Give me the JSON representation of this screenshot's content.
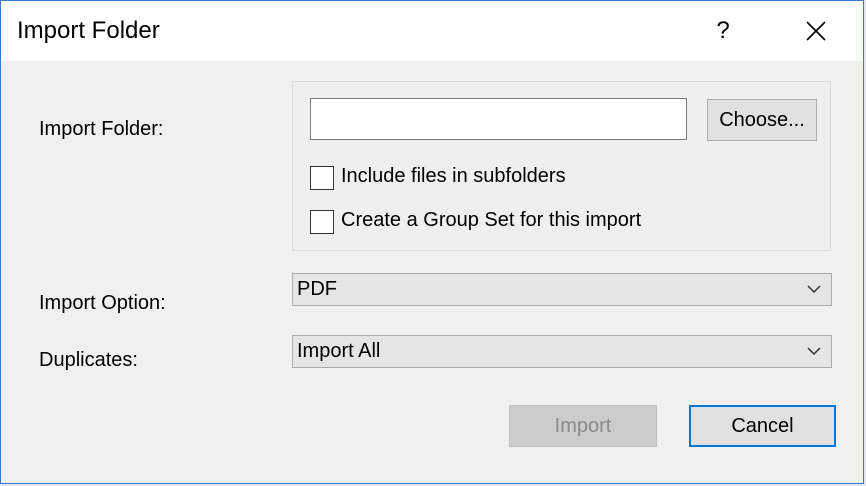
{
  "dialog": {
    "title": "Import Folder",
    "help_label": "?",
    "icons": {
      "close": "close-icon",
      "dropdown": "chevron-down-icon"
    },
    "accent_color": "#0078d7"
  },
  "form": {
    "import_folder_label": "Import Folder:",
    "folder_path": {
      "value": "",
      "placeholder": ""
    },
    "choose_label": "Choose...",
    "include_subfolders": {
      "label": "Include files in subfolders",
      "checked": false
    },
    "create_group_set": {
      "label": "Create a Group Set for this import",
      "checked": false
    },
    "import_option_label": "Import Option:",
    "import_option_value": "PDF",
    "duplicates_label": "Duplicates:",
    "duplicates_value": "Import All"
  },
  "buttons": {
    "import_label": "Import",
    "import_enabled": false,
    "cancel_label": "Cancel"
  }
}
